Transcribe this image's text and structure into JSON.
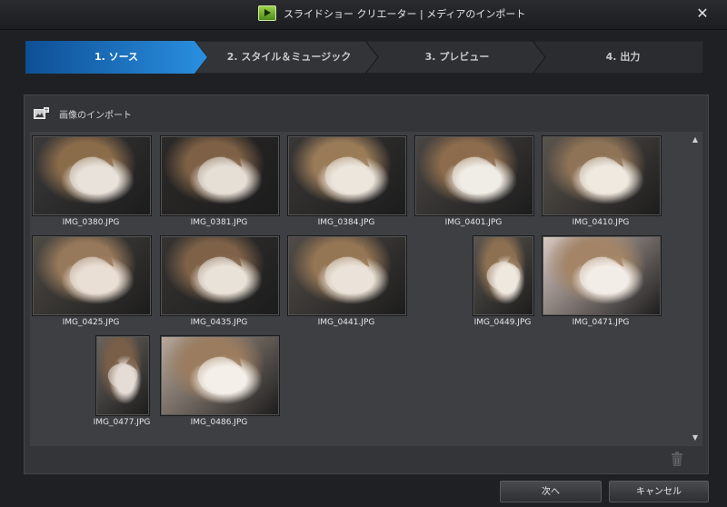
{
  "window": {
    "title": "スライドショー クリエーター | メディアのインポート",
    "close_glyph": "✕"
  },
  "steps": [
    {
      "label": "1. ソース",
      "active": true
    },
    {
      "label": "2. スタイル＆ミュージック",
      "active": false
    },
    {
      "label": "3. プレビュー",
      "active": false
    },
    {
      "label": "4. 出力",
      "active": false
    }
  ],
  "panel": {
    "title": "画像のインポート"
  },
  "thumbnails": [
    {
      "filename": "IMG_0380.JPG",
      "palette": [
        "#3b3a3a",
        "#e8e2da",
        "#8a6b4a"
      ]
    },
    {
      "filename": "IMG_0381.JPG",
      "palette": [
        "#2c2a29",
        "#e6dfd6",
        "#7d6045"
      ]
    },
    {
      "filename": "IMG_0384.JPG",
      "palette": [
        "#3a3837",
        "#ece6dd",
        "#9a7b58"
      ]
    },
    {
      "filename": "IMG_0401.JPG",
      "palette": [
        "#4a4644",
        "#f0ece6",
        "#8c6c4c"
      ]
    },
    {
      "filename": "IMG_0410.JPG",
      "palette": [
        "#5a544e",
        "#efe9e0",
        "#8e7356"
      ]
    },
    {
      "filename": "IMG_0425.JPG",
      "palette": [
        "#4e4a44",
        "#eadfd5",
        "#96785a"
      ]
    },
    {
      "filename": "IMG_0435.JPG",
      "palette": [
        "#363433",
        "#e9e2d8",
        "#7e6248"
      ]
    },
    {
      "filename": "IMG_0441.JPG",
      "palette": [
        "#514c47",
        "#ebe3d9",
        "#947554"
      ]
    },
    {
      "filename": "IMG_0449.JPG",
      "palette": [
        "#5b5650",
        "#efe8de",
        "#8d7052"
      ]
    },
    {
      "filename": "IMG_0471.JPG",
      "palette": [
        "#d9c9c2",
        "#f3ede7",
        "#a38466"
      ]
    },
    {
      "filename": "IMG_0477.JPG",
      "palette": [
        "#6a6560",
        "#e5dcd6",
        "#7a5f48"
      ]
    },
    {
      "filename": "IMG_0486.JPG",
      "palette": [
        "#b9a99c",
        "#f4efe9",
        "#9b7c5e"
      ]
    }
  ],
  "scrollbar": {
    "up_glyph": "▲",
    "down_glyph": "▼"
  },
  "buttons": {
    "next_label": "次へ",
    "cancel_label": "キャンセル"
  },
  "colors": {
    "active_step": "#1f7fd0",
    "inactive_step": "#2f3033"
  }
}
